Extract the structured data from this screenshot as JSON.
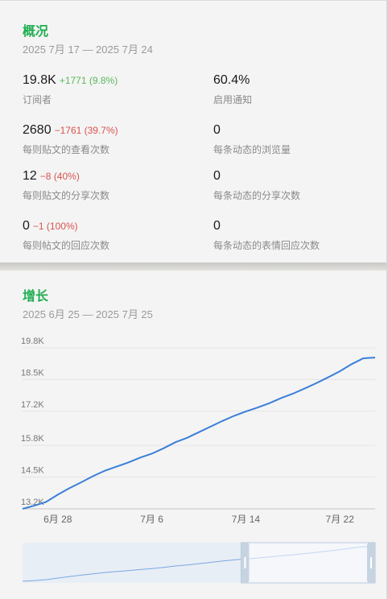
{
  "overview": {
    "title": "概况",
    "date_range": "2025 7月 17 — 2025 7月 24",
    "stats": [
      {
        "value": "19.8K",
        "delta": "+1771 (9.8%)",
        "delta_dir": "up",
        "label": "订阅者"
      },
      {
        "value": "60.4%",
        "delta": "",
        "delta_dir": "",
        "label": "启用通知"
      },
      {
        "value": "2680",
        "delta": "−1761 (39.7%)",
        "delta_dir": "down",
        "label": "每则贴文的查看次数"
      },
      {
        "value": "0",
        "delta": "",
        "delta_dir": "",
        "label": "每条动态的浏览量"
      },
      {
        "value": "12",
        "delta": "−8 (40%)",
        "delta_dir": "down",
        "label": "每则贴文的分享次数"
      },
      {
        "value": "0",
        "delta": "",
        "delta_dir": "",
        "label": "每条动态的分享次数"
      },
      {
        "value": "0",
        "delta": "−1 (100%)",
        "delta_dir": "down",
        "label": "每则帖文的回应次数"
      },
      {
        "value": "0",
        "delta": "",
        "delta_dir": "",
        "label": "每条动态的表情回应次数"
      }
    ]
  },
  "growth": {
    "title": "增长",
    "date_range": "2025 6月 25 — 2025 7月 25"
  },
  "colors": {
    "accent": "#1fae51",
    "line": "#3a7fd9",
    "up": "#5cb85c",
    "down": "#d9534f"
  },
  "chart_data": {
    "type": "line",
    "title": "",
    "xlabel": "",
    "ylabel": "",
    "ylim": [
      13200,
      19800
    ],
    "y_ticks": [
      13200,
      14500,
      15800,
      17200,
      18500,
      19800
    ],
    "y_tick_labels": [
      "13.2K",
      "14.5K",
      "15.8K",
      "17.2K",
      "18.5K",
      "19.8K"
    ],
    "x_tick_labels": [
      "6月 28",
      "7月 6",
      "7月 14",
      "7月 22"
    ],
    "x_tick_days": [
      3,
      11,
      19,
      27
    ],
    "grid": true,
    "series": [
      {
        "name": "",
        "x_days": [
          0,
          1,
          2,
          3,
          4,
          5,
          6,
          7,
          8,
          9,
          10,
          11,
          12,
          13,
          14,
          15,
          16,
          17,
          18,
          19,
          20,
          21,
          22,
          23,
          24,
          25,
          26,
          27,
          28,
          29,
          30
        ],
        "values": [
          13200,
          13330,
          13480,
          13780,
          14050,
          14290,
          14540,
          14760,
          14930,
          15100,
          15300,
          15460,
          15680,
          15930,
          16110,
          16340,
          16570,
          16800,
          17010,
          17190,
          17350,
          17530,
          17740,
          17920,
          18130,
          18350,
          18590,
          18840,
          19130,
          19370,
          19400
        ]
      }
    ],
    "navigator_range": [
      19,
      30
    ]
  }
}
